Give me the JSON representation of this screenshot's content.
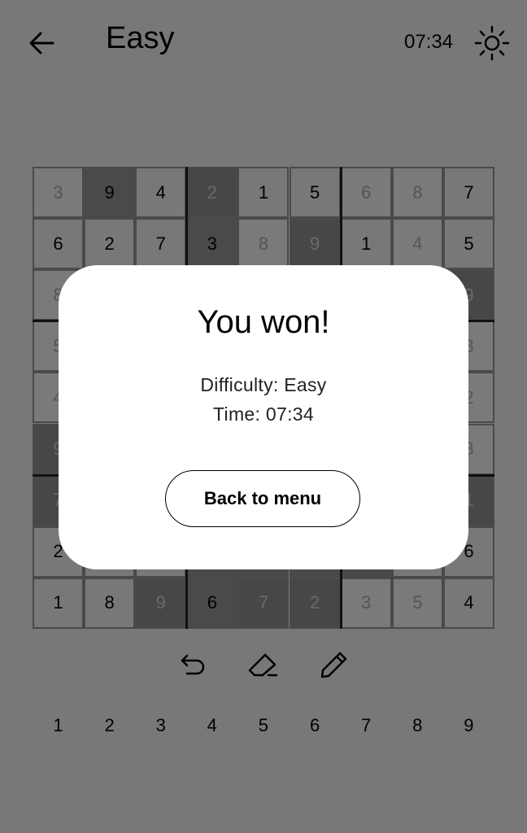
{
  "header": {
    "title": "Easy",
    "timer": "07:34",
    "back_icon": "arrow-left-icon",
    "theme_icon": "sun-icon"
  },
  "board": {
    "rows": [
      [
        "3",
        "9",
        "4",
        "2",
        "1",
        "5",
        "6",
        "8",
        "7"
      ],
      [
        "6",
        "2",
        "7",
        "3",
        "8",
        "9",
        "1",
        "4",
        "5"
      ],
      [
        "8",
        "",
        "",
        "",
        "",
        "",
        "",
        "",
        "9"
      ],
      [
        "5",
        "",
        "",
        "",
        "",
        "",
        "",
        "",
        "3"
      ],
      [
        "4",
        "",
        "",
        "",
        "",
        "",
        "",
        "",
        "2"
      ],
      [
        "9",
        "",
        "",
        "",
        "",
        "",
        "",
        "",
        "8"
      ],
      [
        "7",
        "",
        "",
        "",
        "",
        "",
        "",
        "",
        "1"
      ],
      [
        "2",
        "",
        "",
        "",
        "",
        "",
        "",
        "",
        "6"
      ],
      [
        "1",
        "8",
        "9",
        "6",
        "7",
        "2",
        "3",
        "5",
        "4"
      ]
    ],
    "styles": [
      [
        "filled",
        "hl",
        "given",
        "hlf",
        "given",
        "given",
        "filled",
        "filled",
        "given"
      ],
      [
        "given",
        "given",
        "given",
        "hl",
        "filled",
        "hlf",
        "given",
        "filled",
        "given"
      ],
      [
        "filled",
        "given",
        "given",
        "given",
        "given",
        "given",
        "given",
        "given",
        "hlf"
      ],
      [
        "filled",
        "given",
        "given",
        "given",
        "given",
        "given",
        "given",
        "given",
        "filled"
      ],
      [
        "filled",
        "given",
        "given",
        "given",
        "given",
        "given",
        "given",
        "given",
        "filled"
      ],
      [
        "hlf",
        "given",
        "given",
        "given",
        "given",
        "given",
        "given",
        "given",
        "filled"
      ],
      [
        "hlf",
        "given",
        "given",
        "given",
        "given",
        "given",
        "given",
        "given",
        "hlf"
      ],
      [
        "given",
        "given",
        "given",
        "hl",
        "hl",
        "hl",
        "hl",
        "given",
        "given"
      ],
      [
        "given",
        "given",
        "hlf",
        "hl",
        "hlf",
        "hlf",
        "filled",
        "filled",
        "given"
      ]
    ]
  },
  "tools": [
    {
      "name": "undo-icon"
    },
    {
      "name": "eraser-icon"
    },
    {
      "name": "pencil-icon"
    }
  ],
  "numpad": [
    "1",
    "2",
    "3",
    "4",
    "5",
    "6",
    "7",
    "8",
    "9"
  ],
  "dialog": {
    "title": "You won!",
    "difficulty": "Difficulty: Easy",
    "time": "Time: 07:34",
    "button_label": "Back to menu"
  },
  "colors": {
    "background": "#787878",
    "cell_highlight": "#4a4a4a",
    "dialog": "#ffffff"
  }
}
